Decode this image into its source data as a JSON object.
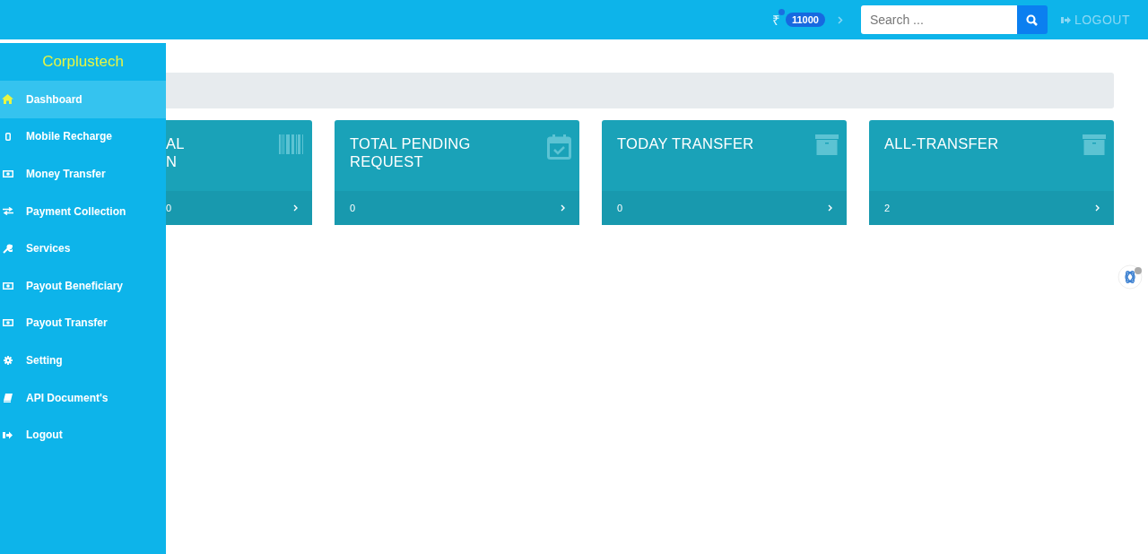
{
  "header": {
    "currency": "₹",
    "balance": "11000",
    "search": {
      "placeholder": "Search ..."
    },
    "logout": "LOGOUT"
  },
  "sidebar": {
    "brand": "Corplustech",
    "items": [
      {
        "label": "Dashboard",
        "selected": true
      },
      {
        "label": "Mobile Recharge",
        "selected": false
      },
      {
        "label": "Money Transfer",
        "selected": false
      },
      {
        "label": "Payment Collection",
        "selected": false
      },
      {
        "label": "Services",
        "selected": false
      },
      {
        "label": "Payout Beneficiary",
        "selected": false
      },
      {
        "label": "Payout Transfer",
        "selected": false
      },
      {
        "label": "Setting",
        "selected": false
      },
      {
        "label": "API Document's",
        "selected": false
      },
      {
        "label": "Logout",
        "selected": false
      }
    ]
  },
  "cards": [
    {
      "title_lines": [
        "AL",
        "N"
      ],
      "value": "0"
    },
    {
      "title_lines": [
        "TOTAL PENDING",
        "REQUEST"
      ],
      "value": "0"
    },
    {
      "title_lines": [
        "TODAY TRANSFER"
      ],
      "value": "0"
    },
    {
      "title_lines": [
        "ALL-TRANSFER"
      ],
      "value": "2"
    }
  ]
}
